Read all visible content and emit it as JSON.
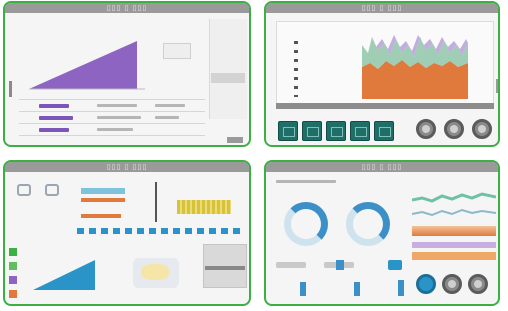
{
  "screens": [
    {
      "id": "top-left",
      "title": "▯▯▯ ▯ ▯▯▯"
    },
    {
      "id": "top-right",
      "title": "▯▯▯ ▯ ▯▯▯"
    },
    {
      "id": "bottom-left",
      "title": "▯▯▯ ▯ ▯▯▯"
    },
    {
      "id": "bottom-right",
      "title": "▯▯▯ ▯ ▯▯▯"
    }
  ],
  "colors": {
    "border_accent": "#3cb043",
    "purple_series": "#8e64c2",
    "orange_area": "#e07a3c",
    "teal_button": "#1e6f67",
    "blue_accent": "#2a94c9",
    "gauge_blue": "#3d8fc8"
  },
  "icons": [
    "gear-icon",
    "knob-icon",
    "button-icon"
  ]
}
